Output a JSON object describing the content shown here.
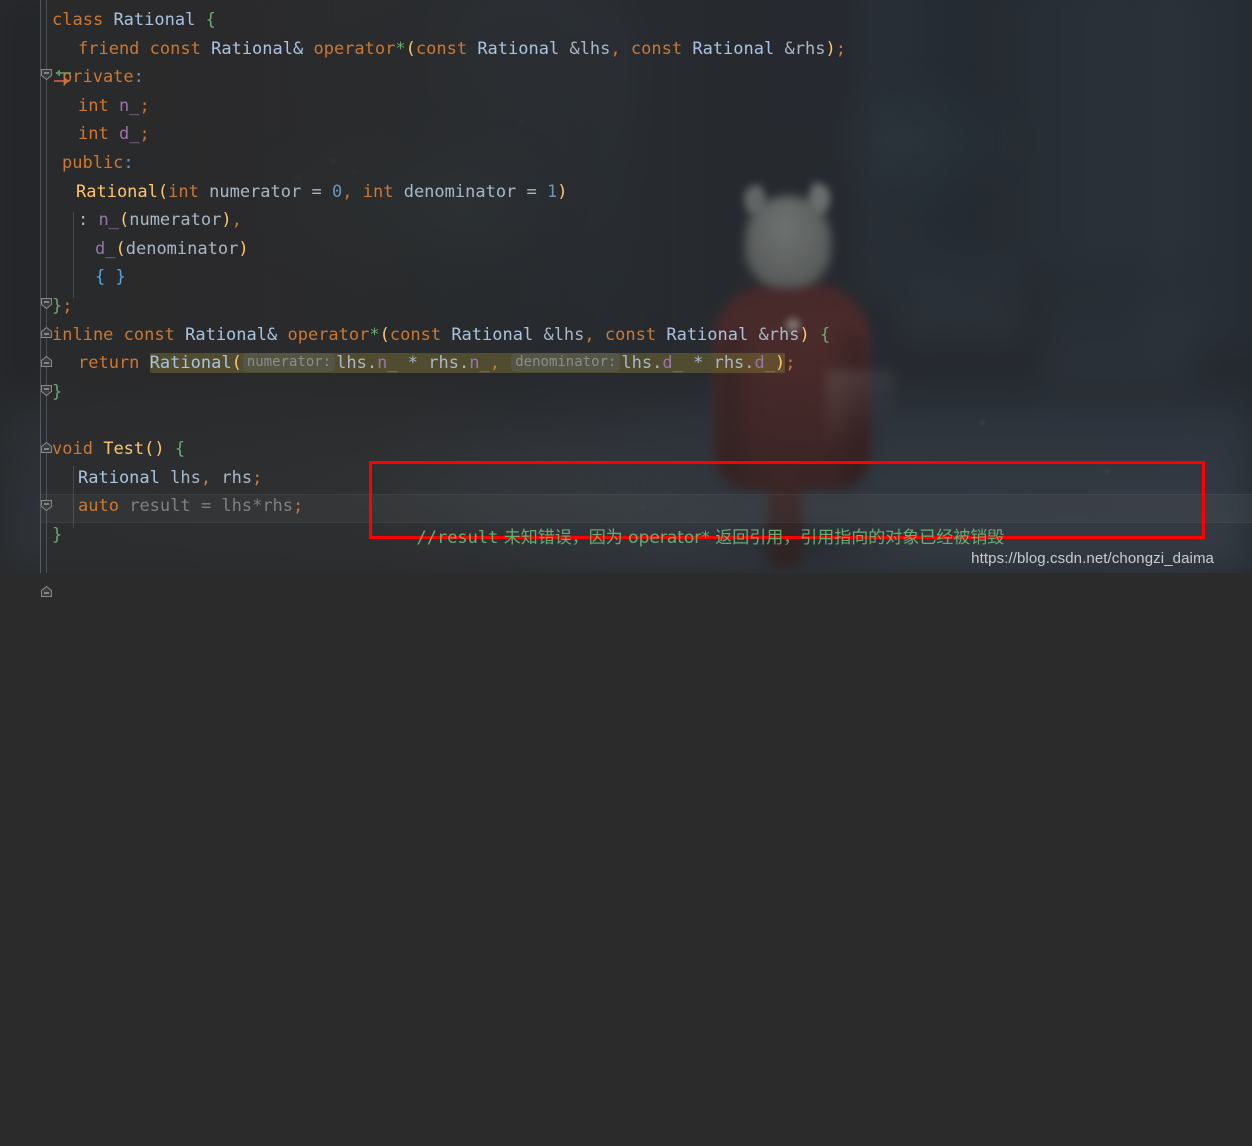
{
  "app": {
    "kind": "code-editor",
    "theme": "darcula-with-background-image",
    "background_description": "blurred dark game screenshot of a caped character seen from behind"
  },
  "gutter": {
    "icons": [
      {
        "name": "related-symbol-arrows-icon",
        "line": 2,
        "glyph": "left-right-arrows",
        "colors": [
          "#4f9e5b",
          "#d05a52"
        ]
      }
    ],
    "fold_markers": [
      {
        "line": 1,
        "state": "expanded-start"
      },
      {
        "line": 9,
        "state": "expanded-end"
      },
      {
        "line": 10,
        "state": "expanded-end"
      },
      {
        "line": 11,
        "state": "expanded-end"
      },
      {
        "line": 12,
        "state": "expanded-start"
      },
      {
        "line": 14,
        "state": "expanded-end"
      },
      {
        "line": 16,
        "state": "expanded-start"
      },
      {
        "line": 19,
        "state": "expanded-end"
      }
    ]
  },
  "code": {
    "language": "C++",
    "lines": [
      {
        "n": 1,
        "text": "class Rational {"
      },
      {
        "n": 2,
        "text": "  friend const Rational& operator*(const Rational &lhs, const Rational &rhs);"
      },
      {
        "n": 3,
        "text": " private:"
      },
      {
        "n": 4,
        "text": "  int n_;"
      },
      {
        "n": 5,
        "text": "  int d_;"
      },
      {
        "n": 6,
        "text": " public:"
      },
      {
        "n": 7,
        "text": "  Rational(int numerator = 0, int denominator = 1)"
      },
      {
        "n": 8,
        "text": "   : n_(numerator),"
      },
      {
        "n": 9,
        "text": "     d_(denominator)"
      },
      {
        "n": 10,
        "text": "     { }"
      },
      {
        "n": 11,
        "text": "};"
      },
      {
        "n": 12,
        "text": "inline const Rational& operator*(const Rational &lhs, const Rational &rhs) {"
      },
      {
        "n": 13,
        "text": "  return Rational( numerator: lhs.n_ * rhs.n_,  denominator: lhs.d_ * rhs.d_);"
      },
      {
        "n": 14,
        "text": "}"
      },
      {
        "n": 15,
        "text": ""
      },
      {
        "n": 16,
        "text": "void Test() {"
      },
      {
        "n": 17,
        "text": "  Rational lhs, rhs;"
      },
      {
        "n": 18,
        "text": "  auto result = lhs*rhs;"
      },
      {
        "n": 19,
        "text": "}"
      }
    ],
    "inlay_hints": [
      "numerator:",
      "denominator:"
    ],
    "highlighted_call": "Rational( numerator: lhs.n_ * rhs.n_,  denominator: lhs.d_ * rhs.d_)",
    "caret_line_number": 18,
    "unused_identifier": "result"
  },
  "tokens": {
    "l1": {
      "kw": "class",
      "type": "Rational",
      "brace": "{"
    },
    "l2": {
      "kw1": "friend",
      "kw2": "const",
      "type": "Rational&",
      "fn": "operator",
      "star": "*",
      "p1": "const",
      "t1": "Rational",
      "a1": "&lhs",
      "p2": "const",
      "t2": "Rational",
      "a2": "&rhs"
    },
    "l3": {
      "kw": "private",
      "colon": ":"
    },
    "l4": {
      "kw": "int",
      "field": "n_",
      "semi": ";"
    },
    "l5": {
      "kw": "int",
      "field": "d_",
      "semi": ";"
    },
    "l6": {
      "kw": "public",
      "colon": ":"
    },
    "l7": {
      "ctor": "Rational",
      "kw1": "int",
      "p1": "numerator",
      "eq": "=",
      "n1": "0",
      "kw2": "int",
      "p2": "denominator",
      "n2": "1"
    },
    "l8": {
      "init": ":",
      "field": "n_",
      "arg": "numerator"
    },
    "l9": {
      "field": "d_",
      "arg": "denominator"
    },
    "l10": {
      "braces": "{ }"
    },
    "l11": {
      "close": "};"
    },
    "l12": {
      "kw1": "inline",
      "kw2": "const",
      "type": "Rational&",
      "fn": "operator",
      "star": "*"
    },
    "l13": {
      "kw": "return",
      "ctor": "Rational",
      "hint1": "numerator:",
      "e1": "lhs.n_",
      "mul": "*",
      "e2": "rhs.n_",
      "hint2": "denominator:",
      "e3": "lhs.d_",
      "e4": "rhs.d_"
    },
    "l16": {
      "kw": "void",
      "fn": "Test",
      "parens": "()",
      "brace": "{"
    },
    "l17": {
      "type": "Rational",
      "v1": "lhs",
      "v2": "rhs"
    },
    "l18": {
      "kw": "auto",
      "var": "result",
      "eq": "=",
      "expr": "lhs*rhs",
      "semi": ";"
    }
  },
  "annotation": {
    "box": {
      "name": "red-highlight-rectangle",
      "color": "#ff0000",
      "border_width": 3
    },
    "comment": {
      "prefix": "//result",
      "body": " 未知错误，因为 operator* 返回引用，引用指向的对象已经被销毁",
      "full": "//result 未知错误，因为 operator* 返回引用，引用指向的对象已经被销毁",
      "color": "#6aab73"
    }
  },
  "watermark": {
    "text": "https://blog.csdn.net/chongzi_daima",
    "color": "#c9cdd1"
  },
  "colors": {
    "editor_background": "#2b2b2b",
    "keyword": "#cc7832",
    "type": "#a9c3e0",
    "function": "#ffc66d",
    "field": "#9876aa",
    "number": "#6897bb",
    "string_brace_green": "#6aab73",
    "default_text": "#a9b7c6",
    "unused_gray": "#808080",
    "hint_pill": "#8c8c8c",
    "highlight_olive": "#7d7434",
    "annotation_red": "#ff0000"
  }
}
